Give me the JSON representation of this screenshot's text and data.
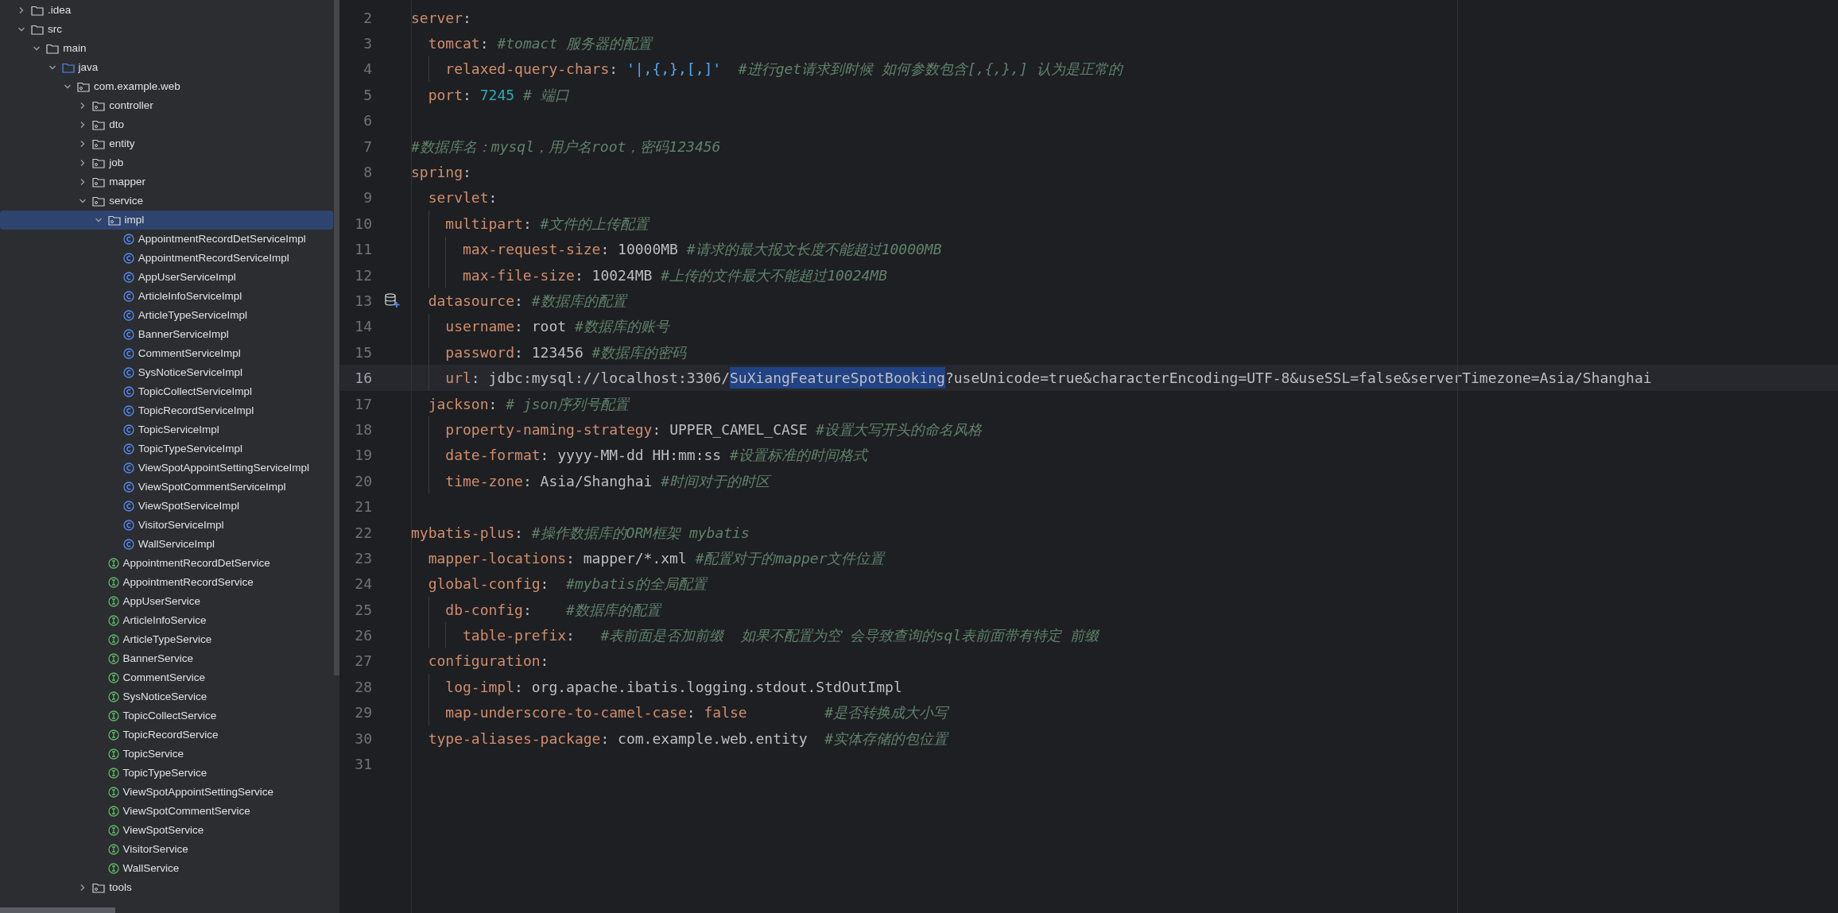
{
  "project_tree": [
    {
      "label": ".idea",
      "kind": "folder",
      "expanded": false,
      "selected": false
    },
    {
      "label": "src",
      "kind": "folder",
      "expanded": true,
      "selected": false,
      "children": [
        {
          "label": "main",
          "kind": "folder",
          "expanded": true,
          "selected": false,
          "children": [
            {
              "label": "java",
              "kind": "source",
              "expanded": true,
              "selected": false,
              "children": [
                {
                  "label": "com.example.web",
                  "kind": "package",
                  "expanded": true,
                  "selected": false,
                  "children": [
                    {
                      "label": "controller",
                      "kind": "package",
                      "expanded": false,
                      "selected": false
                    },
                    {
                      "label": "dto",
                      "kind": "package",
                      "expanded": false,
                      "selected": false
                    },
                    {
                      "label": "entity",
                      "kind": "package",
                      "expanded": false,
                      "selected": false
                    },
                    {
                      "label": "job",
                      "kind": "package",
                      "expanded": false,
                      "selected": false
                    },
                    {
                      "label": "mapper",
                      "kind": "package",
                      "expanded": false,
                      "selected": false
                    },
                    {
                      "label": "service",
                      "kind": "package",
                      "expanded": true,
                      "selected": false,
                      "children": [
                        {
                          "label": "impl",
                          "kind": "package",
                          "expanded": true,
                          "selected": true,
                          "children": [
                            {
                              "label": "AppointmentRecordDetServiceImpl",
                              "kind": "class",
                              "selected": false
                            },
                            {
                              "label": "AppointmentRecordServiceImpl",
                              "kind": "class",
                              "selected": false
                            },
                            {
                              "label": "AppUserServiceImpl",
                              "kind": "class",
                              "selected": false
                            },
                            {
                              "label": "ArticleInfoServiceImpl",
                              "kind": "class",
                              "selected": false
                            },
                            {
                              "label": "ArticleTypeServiceImpl",
                              "kind": "class",
                              "selected": false
                            },
                            {
                              "label": "BannerServiceImpl",
                              "kind": "class",
                              "selected": false
                            },
                            {
                              "label": "CommentServiceImpl",
                              "kind": "class",
                              "selected": false
                            },
                            {
                              "label": "SysNoticeServiceImpl",
                              "kind": "class",
                              "selected": false
                            },
                            {
                              "label": "TopicCollectServiceImpl",
                              "kind": "class",
                              "selected": false
                            },
                            {
                              "label": "TopicRecordServiceImpl",
                              "kind": "class",
                              "selected": false
                            },
                            {
                              "label": "TopicServiceImpl",
                              "kind": "class",
                              "selected": false
                            },
                            {
                              "label": "TopicTypeServiceImpl",
                              "kind": "class",
                              "selected": false
                            },
                            {
                              "label": "ViewSpotAppointSettingServiceImpl",
                              "kind": "class",
                              "selected": false
                            },
                            {
                              "label": "ViewSpotCommentServiceImpl",
                              "kind": "class",
                              "selected": false
                            },
                            {
                              "label": "ViewSpotServiceImpl",
                              "kind": "class",
                              "selected": false
                            },
                            {
                              "label": "VisitorServiceImpl",
                              "kind": "class",
                              "selected": false
                            },
                            {
                              "label": "WallServiceImpl",
                              "kind": "class",
                              "selected": false
                            }
                          ]
                        },
                        {
                          "label": "AppointmentRecordDetService",
                          "kind": "interface",
                          "selected": false
                        },
                        {
                          "label": "AppointmentRecordService",
                          "kind": "interface",
                          "selected": false
                        },
                        {
                          "label": "AppUserService",
                          "kind": "interface",
                          "selected": false
                        },
                        {
                          "label": "ArticleInfoService",
                          "kind": "interface",
                          "selected": false
                        },
                        {
                          "label": "ArticleTypeService",
                          "kind": "interface",
                          "selected": false
                        },
                        {
                          "label": "BannerService",
                          "kind": "interface",
                          "selected": false
                        },
                        {
                          "label": "CommentService",
                          "kind": "interface",
                          "selected": false
                        },
                        {
                          "label": "SysNoticeService",
                          "kind": "interface",
                          "selected": false
                        },
                        {
                          "label": "TopicCollectService",
                          "kind": "interface",
                          "selected": false
                        },
                        {
                          "label": "TopicRecordService",
                          "kind": "interface",
                          "selected": false
                        },
                        {
                          "label": "TopicService",
                          "kind": "interface",
                          "selected": false
                        },
                        {
                          "label": "TopicTypeService",
                          "kind": "interface",
                          "selected": false
                        },
                        {
                          "label": "ViewSpotAppointSettingService",
                          "kind": "interface",
                          "selected": false
                        },
                        {
                          "label": "ViewSpotCommentService",
                          "kind": "interface",
                          "selected": false
                        },
                        {
                          "label": "ViewSpotService",
                          "kind": "interface",
                          "selected": false
                        },
                        {
                          "label": "VisitorService",
                          "kind": "interface",
                          "selected": false
                        },
                        {
                          "label": "WallService",
                          "kind": "interface",
                          "selected": false
                        }
                      ]
                    },
                    {
                      "label": "tools",
                      "kind": "package",
                      "expanded": false,
                      "selected": false
                    }
                  ]
                }
              ]
            }
          ]
        }
      ]
    }
  ],
  "editor": {
    "lines": [
      {
        "number": "2",
        "current": false,
        "tokens": [
          {
            "kind": "key",
            "text": "server"
          },
          {
            "kind": "punct",
            "text": ":"
          }
        ]
      },
      {
        "number": "3",
        "current": false,
        "tokens": [
          {
            "kind": "key",
            "text": "  tomcat"
          },
          {
            "kind": "punct",
            "text": ": "
          },
          {
            "kind": "comment",
            "text": "#tomact 服务器的配置"
          }
        ]
      },
      {
        "number": "4",
        "current": false,
        "tokens": [
          {
            "kind": "key",
            "text": "    relaxed-query-chars"
          },
          {
            "kind": "punct",
            "text": ": "
          },
          {
            "kind": "string",
            "text": "'|,{,},[,]'"
          },
          {
            "kind": "comment",
            "text": "  #进行get请求到时候 如何参数包含[,{,},] 认为是正常的"
          }
        ]
      },
      {
        "number": "5",
        "current": false,
        "tokens": [
          {
            "kind": "key",
            "text": "  port"
          },
          {
            "kind": "punct",
            "text": ": "
          },
          {
            "kind": "number",
            "text": "7245"
          },
          {
            "kind": "comment",
            "text": " # 端口"
          }
        ]
      },
      {
        "number": "6",
        "current": false
      },
      {
        "number": "7",
        "current": false,
        "tokens": [
          {
            "kind": "comment",
            "text": "#数据库名：mysql，用户名root，密码123456"
          }
        ]
      },
      {
        "number": "8",
        "current": false,
        "tokens": [
          {
            "kind": "key",
            "text": "spring"
          },
          {
            "kind": "punct",
            "text": ":"
          }
        ]
      },
      {
        "number": "9",
        "current": false,
        "tokens": [
          {
            "kind": "key",
            "text": "  servlet"
          },
          {
            "kind": "punct",
            "text": ":"
          }
        ]
      },
      {
        "number": "10",
        "current": false,
        "tokens": [
          {
            "kind": "key",
            "text": "    multipart"
          },
          {
            "kind": "punct",
            "text": ": "
          },
          {
            "kind": "comment",
            "text": "#文件的上传配置"
          }
        ]
      },
      {
        "number": "11",
        "current": false,
        "tokens": [
          {
            "kind": "key",
            "text": "      max-request-size"
          },
          {
            "kind": "punct",
            "text": ": "
          },
          {
            "kind": "value",
            "text": "10000MB"
          },
          {
            "kind": "comment",
            "text": " #请求的最大报文长度不能超过10000MB"
          }
        ]
      },
      {
        "number": "12",
        "current": false,
        "tokens": [
          {
            "kind": "key",
            "text": "      max-file-size"
          },
          {
            "kind": "punct",
            "text": ": "
          },
          {
            "kind": "value",
            "text": "10024MB"
          },
          {
            "kind": "comment",
            "text": " #上传的文件最大不能超过10024MB"
          }
        ]
      },
      {
        "number": "13",
        "current": false,
        "gutter_icon": true,
        "tokens": [
          {
            "kind": "key",
            "text": "  datasource"
          },
          {
            "kind": "punct",
            "text": ": "
          },
          {
            "kind": "comment",
            "text": "#数据库的配置"
          }
        ]
      },
      {
        "number": "14",
        "current": false,
        "tokens": [
          {
            "kind": "key",
            "text": "    username"
          },
          {
            "kind": "punct",
            "text": ": "
          },
          {
            "kind": "value",
            "text": "root"
          },
          {
            "kind": "comment",
            "text": " #数据库的账号"
          }
        ]
      },
      {
        "number": "15",
        "current": false,
        "tokens": [
          {
            "kind": "key",
            "text": "    password"
          },
          {
            "kind": "punct",
            "text": ": "
          },
          {
            "kind": "value",
            "text": "123456"
          },
          {
            "kind": "comment",
            "text": " #数据库的密码"
          }
        ]
      },
      {
        "number": "16",
        "current": true,
        "tokens": [
          {
            "kind": "key",
            "text": "    url"
          },
          {
            "kind": "punct",
            "text": ": "
          },
          {
            "kind": "value",
            "text": "jdbc:mysql://localhost:3306/"
          },
          {
            "kind": "selection",
            "text": "SuXiangFeatureSpotBooking"
          },
          {
            "kind": "value",
            "text": "?useUnicode=true&characterEncoding=UTF-8&useSSL=false&serverTimezone=Asia/Shanghai"
          }
        ]
      },
      {
        "number": "17",
        "current": false,
        "tokens": [
          {
            "kind": "key",
            "text": "  jackson"
          },
          {
            "kind": "punct",
            "text": ": "
          },
          {
            "kind": "comment",
            "text": "# json序列号配置"
          }
        ]
      },
      {
        "number": "18",
        "current": false,
        "tokens": [
          {
            "kind": "key",
            "text": "    property-naming-strategy"
          },
          {
            "kind": "punct",
            "text": ": "
          },
          {
            "kind": "value",
            "text": "UPPER_CAMEL_CASE"
          },
          {
            "kind": "comment",
            "text": " #设置大写开头的命名风格"
          }
        ]
      },
      {
        "number": "19",
        "current": false,
        "tokens": [
          {
            "kind": "key",
            "text": "    date-format"
          },
          {
            "kind": "punct",
            "text": ": "
          },
          {
            "kind": "value",
            "text": "yyyy-MM-dd HH:mm:ss"
          },
          {
            "kind": "comment",
            "text": " #设置标准的时间格式"
          }
        ]
      },
      {
        "number": "20",
        "current": false,
        "tokens": [
          {
            "kind": "key",
            "text": "    time-zone"
          },
          {
            "kind": "punct",
            "text": ": "
          },
          {
            "kind": "value",
            "text": "Asia/Shanghai"
          },
          {
            "kind": "comment",
            "text": " #时间对于的时区"
          }
        ]
      },
      {
        "number": "21",
        "current": false
      },
      {
        "number": "22",
        "current": false,
        "tokens": [
          {
            "kind": "key",
            "text": "mybatis-plus"
          },
          {
            "kind": "punct",
            "text": ": "
          },
          {
            "kind": "comment",
            "text": "#操作数据库的ORM框架 mybatis"
          }
        ]
      },
      {
        "number": "23",
        "current": false,
        "tokens": [
          {
            "kind": "key",
            "text": "  mapper-locations"
          },
          {
            "kind": "punct",
            "text": ": "
          },
          {
            "kind": "value",
            "text": "mapper/*.xml"
          },
          {
            "kind": "comment",
            "text": " #配置对于的mapper文件位置"
          }
        ]
      },
      {
        "number": "24",
        "current": false,
        "tokens": [
          {
            "kind": "key",
            "text": "  global-config"
          },
          {
            "kind": "punct",
            "text": ":  "
          },
          {
            "kind": "comment",
            "text": "#mybatis的全局配置"
          }
        ]
      },
      {
        "number": "25",
        "current": false,
        "tokens": [
          {
            "kind": "key",
            "text": "    db-config"
          },
          {
            "kind": "punct",
            "text": ":    "
          },
          {
            "kind": "comment",
            "text": "#数据库的配置"
          }
        ]
      },
      {
        "number": "26",
        "current": false,
        "tokens": [
          {
            "kind": "key",
            "text": "      table-prefix"
          },
          {
            "kind": "punct",
            "text": ":   "
          },
          {
            "kind": "comment",
            "text": "#表前面是否加前缀  如果不配置为空 会导致查询的sql表前面带有特定 前缀"
          }
        ]
      },
      {
        "number": "27",
        "current": false,
        "tokens": [
          {
            "kind": "key",
            "text": "  configuration"
          },
          {
            "kind": "punct",
            "text": ":"
          }
        ]
      },
      {
        "number": "28",
        "current": false,
        "tokens": [
          {
            "kind": "key",
            "text": "    log-impl"
          },
          {
            "kind": "punct",
            "text": ": "
          },
          {
            "kind": "value",
            "text": "org.apache.ibatis.logging.stdout.StdOutImpl"
          }
        ]
      },
      {
        "number": "29",
        "current": false,
        "tokens": [
          {
            "kind": "key",
            "text": "    map-underscore-to-camel-case"
          },
          {
            "kind": "punct",
            "text": ": "
          },
          {
            "kind": "keyword",
            "text": "false"
          },
          {
            "kind": "comment",
            "text": "         #是否转换成大小写"
          }
        ]
      },
      {
        "number": "30",
        "current": false,
        "tokens": [
          {
            "kind": "key",
            "text": "  type-aliases-package"
          },
          {
            "kind": "punct",
            "text": ": "
          },
          {
            "kind": "value",
            "text": "com.example.web.entity"
          },
          {
            "kind": "comment",
            "text": "  #实体存储的包位置"
          }
        ]
      },
      {
        "number": "31",
        "current": false
      }
    ]
  }
}
